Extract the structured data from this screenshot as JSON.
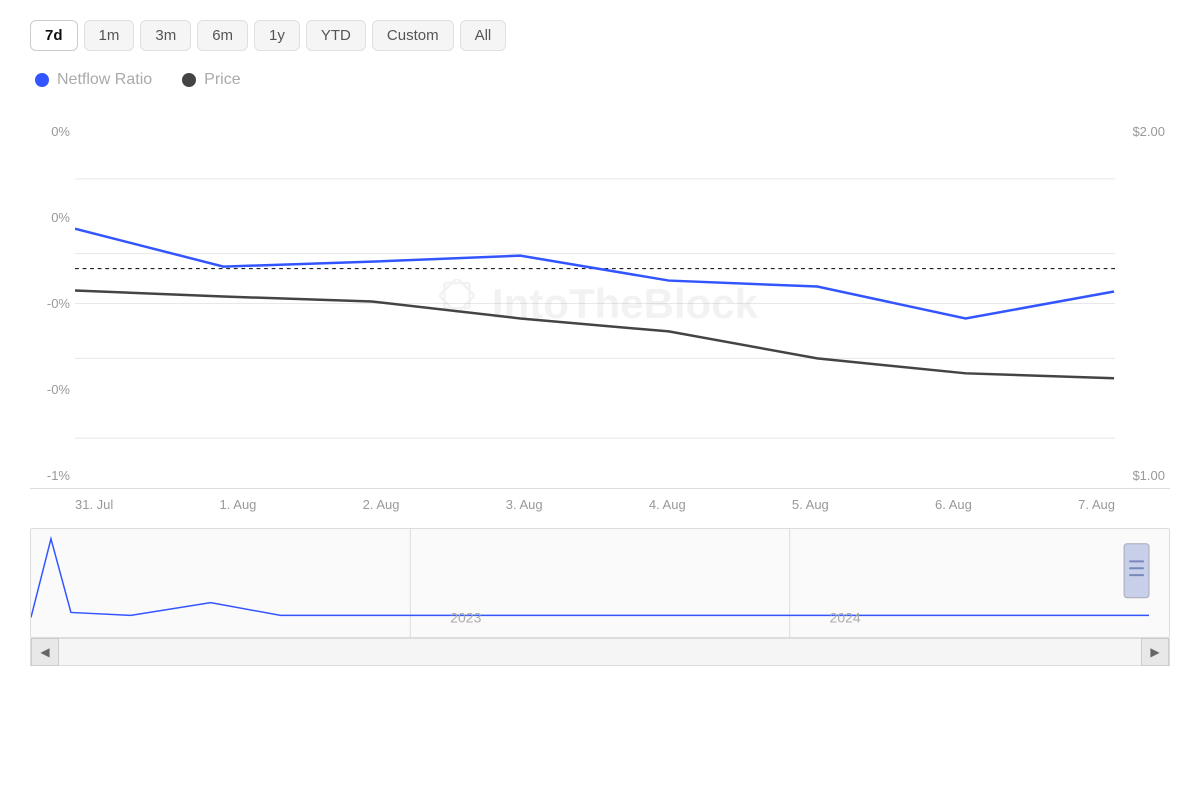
{
  "timeRange": {
    "buttons": [
      {
        "label": "7d",
        "active": true
      },
      {
        "label": "1m",
        "active": false
      },
      {
        "label": "3m",
        "active": false
      },
      {
        "label": "6m",
        "active": false
      },
      {
        "label": "1y",
        "active": false
      },
      {
        "label": "YTD",
        "active": false
      },
      {
        "label": "Custom",
        "active": false
      },
      {
        "label": "All",
        "active": false
      }
    ]
  },
  "legend": {
    "items": [
      {
        "label": "Netflow Ratio",
        "color": "blue"
      },
      {
        "label": "Price",
        "color": "dark"
      }
    ]
  },
  "yAxis": {
    "left": [
      "0%",
      "0%",
      "-0%",
      "-0%",
      "-1%"
    ],
    "right": [
      "$2.00",
      "",
      "",
      "",
      "$1.00"
    ]
  },
  "xAxis": {
    "labels": [
      "31. Jul",
      "1. Aug",
      "2. Aug",
      "3. Aug",
      "4. Aug",
      "5. Aug",
      "6. Aug",
      "7. Aug"
    ]
  },
  "miniChart": {
    "years": [
      "2023",
      "2024"
    ]
  },
  "watermark": "IntoTheBlock"
}
